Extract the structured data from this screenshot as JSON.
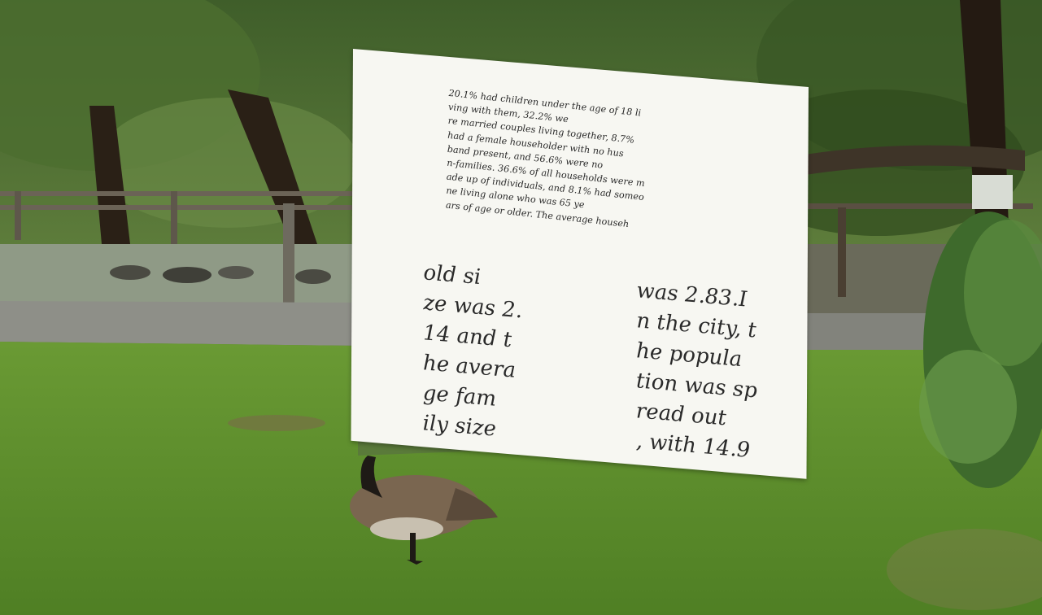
{
  "note": {
    "small_lines": [
      "20.1% had children under the age of 18 li",
      "ving with them, 32.2% we",
      "re married couples living together, 8.7%",
      "had a female householder with no hus",
      "band present, and 56.6% were no",
      "n-families. 36.6% of all households were m",
      "ade up of individuals, and 8.1% had someo",
      "ne living alone who was 65 ye",
      "ars of age or older. The average househ"
    ],
    "left_column": [
      "old si",
      "ze was 2.",
      "14 and t",
      "he avera",
      "ge fam",
      "ily size"
    ],
    "right_column": [
      "was 2.83.I",
      "n the city, t",
      "he popula",
      "tion was sp",
      "read out",
      ", with 14.9"
    ]
  },
  "colors": {
    "grass": "#5d8a2e",
    "foliage": "#2f4a1c",
    "path": "#8e8f88",
    "paper": "#f7f7f2",
    "goose_body": "#7a6650"
  }
}
